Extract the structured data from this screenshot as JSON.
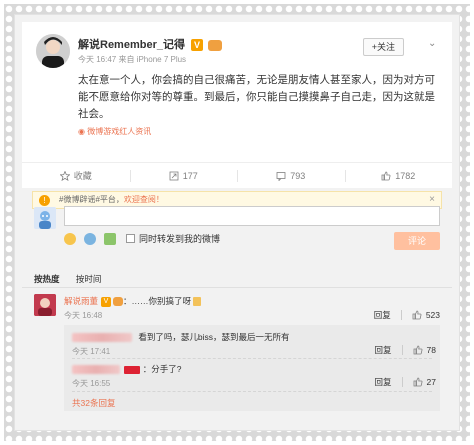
{
  "post": {
    "username": "解说Remember_记得",
    "meta": "今天 16:47 来自 iPhone 7 Plus",
    "follow_label": "+关注",
    "content": "太在意一个人，你会搞的自己很痛苦，无论是朋友情人甚至家人，因为对方可能不愿意给你对等的尊重。到最后，你只能自己摸摸鼻子自己走，因为这就是社会。",
    "source": "微博游戏红人资讯",
    "actions": [
      {
        "label": "收藏",
        "icon": "star-icon"
      },
      {
        "label": "177",
        "icon": "repost-icon"
      },
      {
        "label": "793",
        "icon": "comment-icon"
      },
      {
        "label": "1782",
        "icon": "like-icon"
      }
    ]
  },
  "comment_box": {
    "rumor_prefix": "#微博辟谣#平台，",
    "rumor_link": "欢迎查阅！",
    "checkbox_label": "同时转发到我的微博",
    "submit_label": "评论"
  },
  "sort": {
    "hot": "按热度",
    "time": "按时间"
  },
  "comments": [
    {
      "name": "解说雨董",
      "text": "：……你别搞了呀",
      "time": "今天 16:48",
      "reply_label": "回复",
      "likes": "523"
    }
  ],
  "replies": [
    {
      "text": "看到了吗，瑟儿biss，瑟到最后一无所有",
      "time": "今天 17:41",
      "reply_label": "回复",
      "likes": "78"
    },
    {
      "text": "：分手了?",
      "time": "今天 16:55",
      "reply_label": "回复",
      "likes": "27"
    }
  ],
  "more_label": "共32条回复",
  "colors": {
    "accent": "#eb7350",
    "submit": "#ffc09f"
  }
}
